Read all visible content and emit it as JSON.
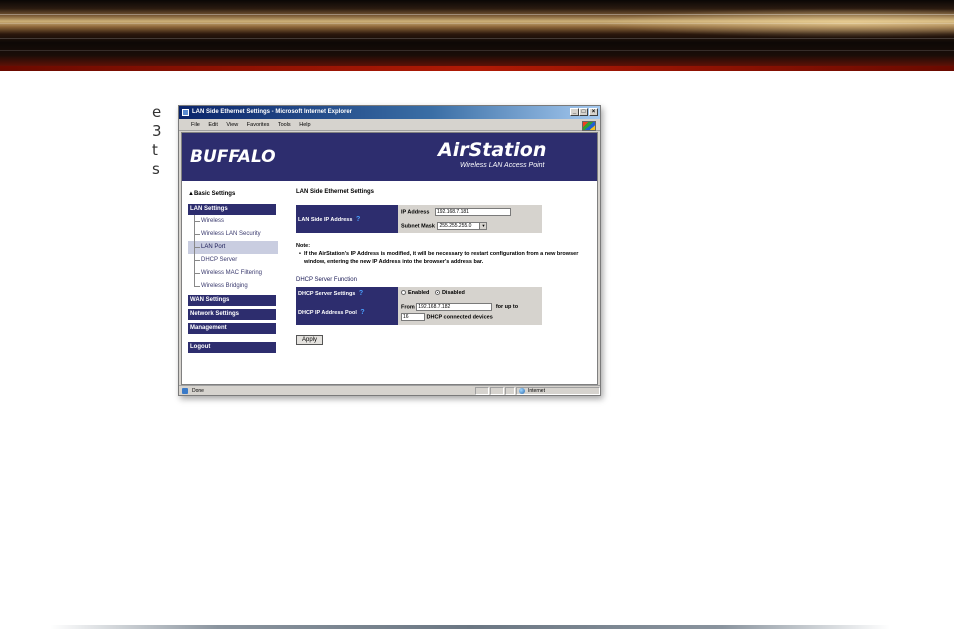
{
  "side_text_fragments": [
    "e",
    "3",
    "t",
    "s"
  ],
  "window": {
    "title": "LAN Side Ethernet Settings - Microsoft Internet Explorer",
    "controls": [
      "_",
      "□",
      "×"
    ],
    "menu": [
      "File",
      "Edit",
      "View",
      "Favorites",
      "Tools",
      "Help"
    ]
  },
  "header": {
    "brand_left": "BUFFALO",
    "brand_right_air": "Air",
    "brand_right_station": "Station",
    "subtitle": "Wireless LAN Access Point"
  },
  "sidebar": {
    "basic_settings": "▲Basic Settings",
    "lan_settings": "LAN Settings",
    "lan_items": [
      "Wireless",
      "Wireless LAN Security",
      "LAN Port",
      "DHCP Server",
      "Wireless MAC Filtering",
      "Wireless Bridging"
    ],
    "active_item": "LAN Port",
    "wan_settings": "WAN Settings",
    "network_settings": "Network Settings",
    "management": "Management",
    "logout": "Logout"
  },
  "main": {
    "heading": "LAN Side Ethernet Settings",
    "ip_section": {
      "label": "LAN Side IP Address",
      "ip_label": "IP Address",
      "ip_value": "192.168.7.181",
      "mask_label": "Subnet Mask",
      "mask_value": "255.255.255.0"
    },
    "note_title": "Note:",
    "note_text": "If the AirStation's IP Address is modified, it will be necessary to restart configuration from a new browser window, entering the new IP Address into the browser's address bar.",
    "dhcp_heading": "DHCP Server Function",
    "dhcp_settings_label": "DHCP Server Settings",
    "dhcp_enabled": "Enabled",
    "dhcp_disabled": "Disabled",
    "dhcp_selected": "Disabled",
    "pool_label": "DHCP IP Address Pool",
    "pool_from_label": "From",
    "pool_from_value": "192.168.7.182",
    "pool_upto_label": "for up to",
    "pool_count": "16",
    "pool_devices_label": "DHCP connected devices",
    "apply_label": "Apply",
    "help_icon": "?"
  },
  "statusbar": {
    "left": "Done",
    "zone": "Internet"
  },
  "colors": {
    "navy": "#2d2d6e",
    "banner_red": "#b01a05",
    "title_blue": "#0a246a"
  }
}
